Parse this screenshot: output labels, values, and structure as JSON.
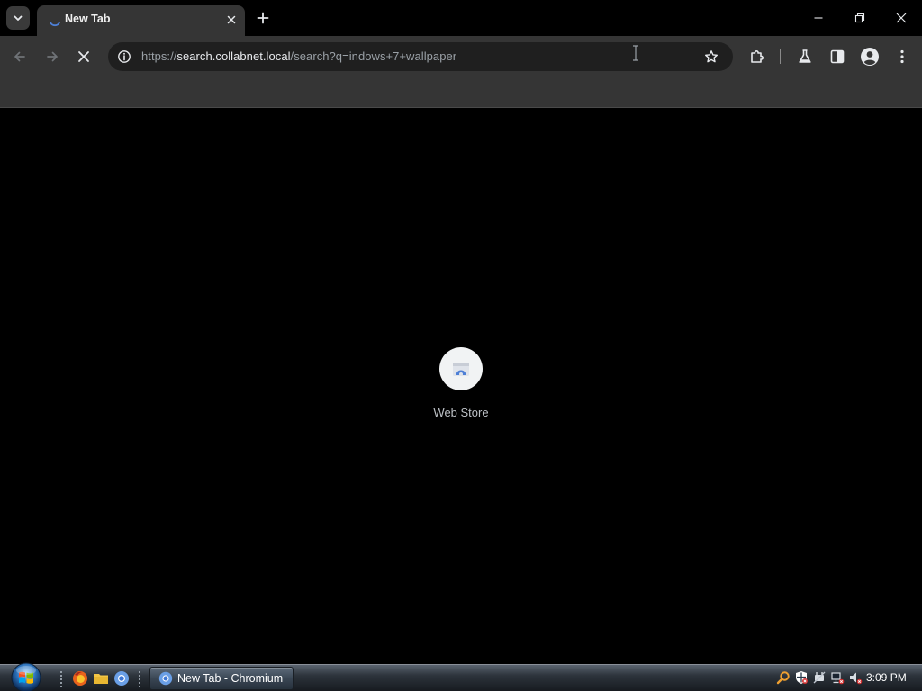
{
  "browser": {
    "tabs": [
      {
        "title": "New Tab"
      }
    ],
    "omnibox": {
      "url_scheme": "https://",
      "url_host": "search.collabnet.local",
      "url_path": "/search?q=indows+7+wallpaper"
    }
  },
  "new_tab_page": {
    "shortcuts": [
      {
        "label": "Web Store"
      }
    ]
  },
  "taskbar": {
    "active_window_label": "New Tab - Chromium",
    "clock": "3:09 PM"
  },
  "colors": {
    "tab_active_bg": "#353535",
    "toolbar_bg": "#353535",
    "omnibox_bg": "#1f1f1f",
    "page_bg": "#000000",
    "link_blue": "#4d7fd6"
  },
  "icons": {
    "tab_search": "chevron-down-icon",
    "favicon": "loading-spinner-icon",
    "tab_close": "close-icon",
    "new_tab": "plus-icon",
    "minimize": "minimize-icon",
    "restore": "restore-icon",
    "close_window": "close-icon",
    "back": "arrow-left-icon",
    "forward": "arrow-right-icon",
    "stop": "stop-x-icon",
    "site_info": "info-icon",
    "bookmark": "star-icon",
    "extensions": "puzzle-icon",
    "labs": "flask-icon",
    "side_panel": "side-panel-icon",
    "profile": "avatar-icon",
    "menu": "kebab-menu-icon"
  }
}
